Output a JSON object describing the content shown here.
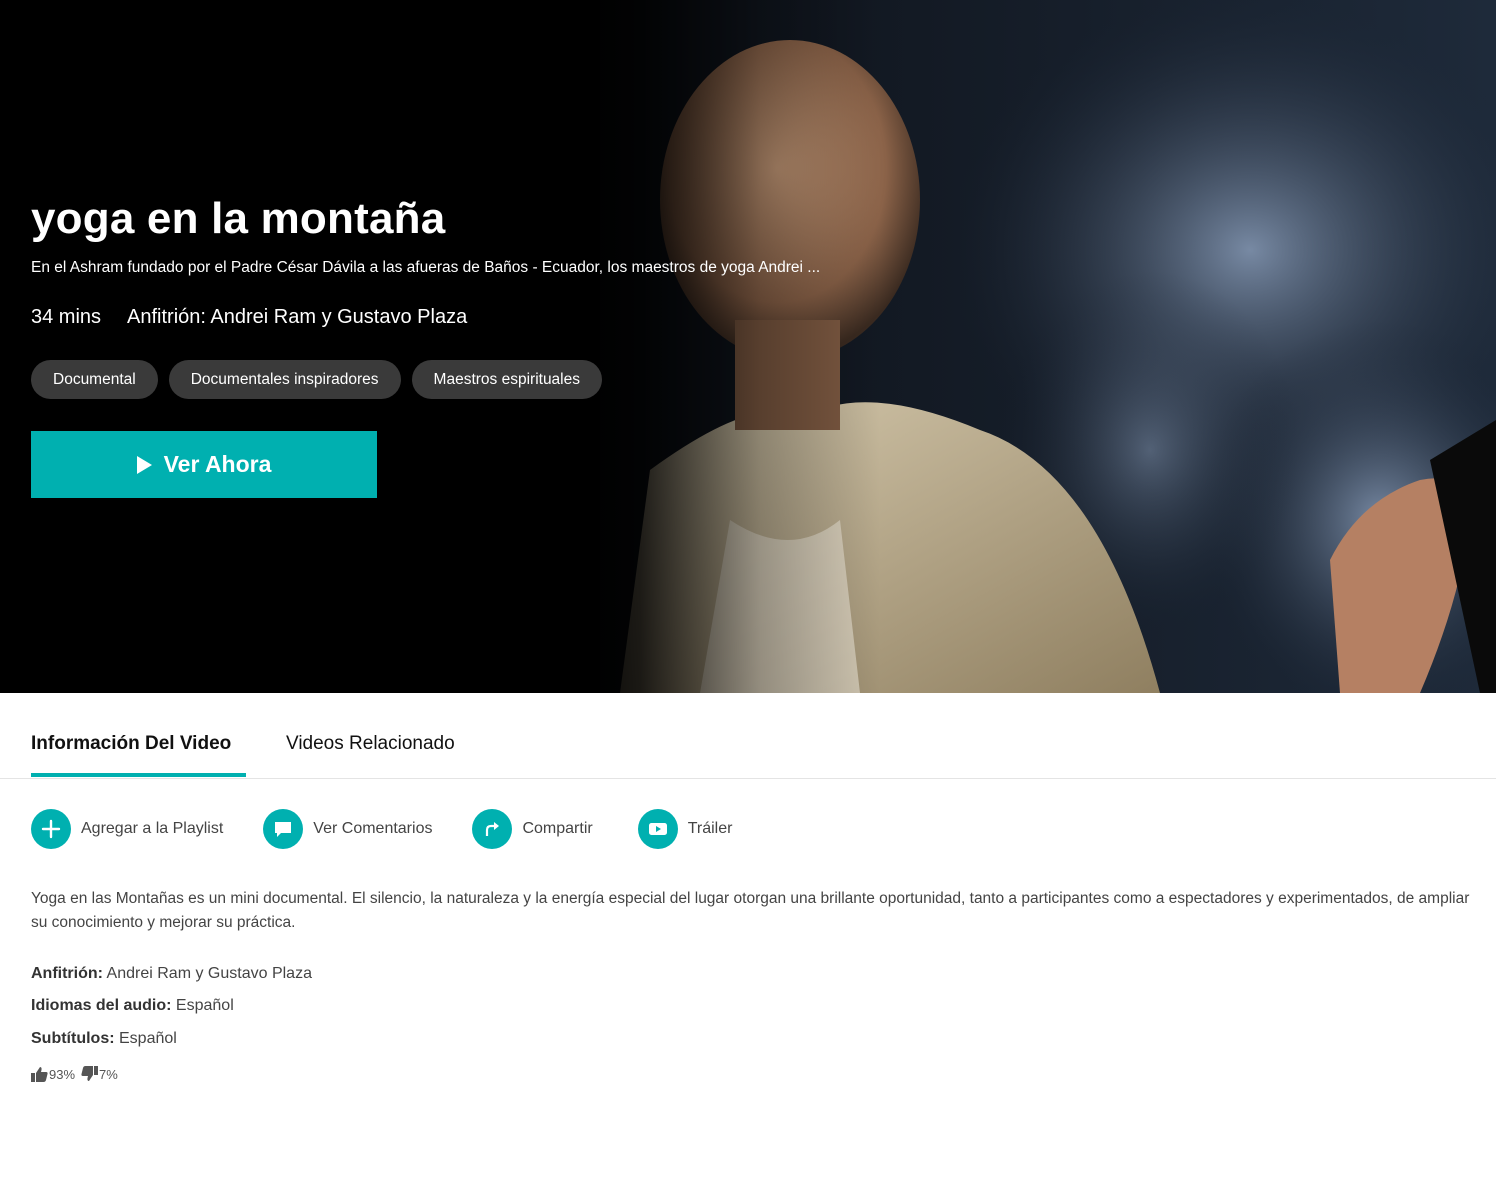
{
  "hero": {
    "title": "yoga en la montaña",
    "description": "En el Ashram fundado por el Padre César Dávila a las afueras de Baños - Ecuador, los maestros de yoga Andrei ...",
    "duration": "34 mins",
    "host": "Anfitrión: Andrei Ram y Gustavo Plaza",
    "tags": [
      "Documental",
      "Documentales inspiradores",
      "Maestros espirituales"
    ],
    "watch_label": "Ver Ahora",
    "accent_color": "#00b0b0"
  },
  "tabs": [
    {
      "label": "Información Del Video",
      "active": true
    },
    {
      "label": "Videos Relacionado",
      "active": false
    }
  ],
  "actions": [
    {
      "label": "Agregar a la Playlist",
      "icon": "plus-icon"
    },
    {
      "label": "Ver Comentarios",
      "icon": "comment-icon"
    },
    {
      "label": "Compartir",
      "icon": "share-icon"
    },
    {
      "label": "Tráiler",
      "icon": "play-video-icon"
    }
  ],
  "details": {
    "synopsis": "Yoga en las Montañas es un mini documental. El silencio, la naturaleza y la energía especial del lugar otorgan una brillante oportunidad, tanto a participantes como a espectadores y experimentados, de ampliar su conocimiento y mejorar su práctica.",
    "host_label": "Anfitrión:",
    "host_value": "Andrei Ram y Gustavo Plaza",
    "audio_label": "Idiomas del audio:",
    "audio_value": "Español",
    "subtitles_label": "Subtítulos:",
    "subtitles_value": "Español"
  },
  "rating": {
    "likes": "93%",
    "dislikes": "7%"
  }
}
